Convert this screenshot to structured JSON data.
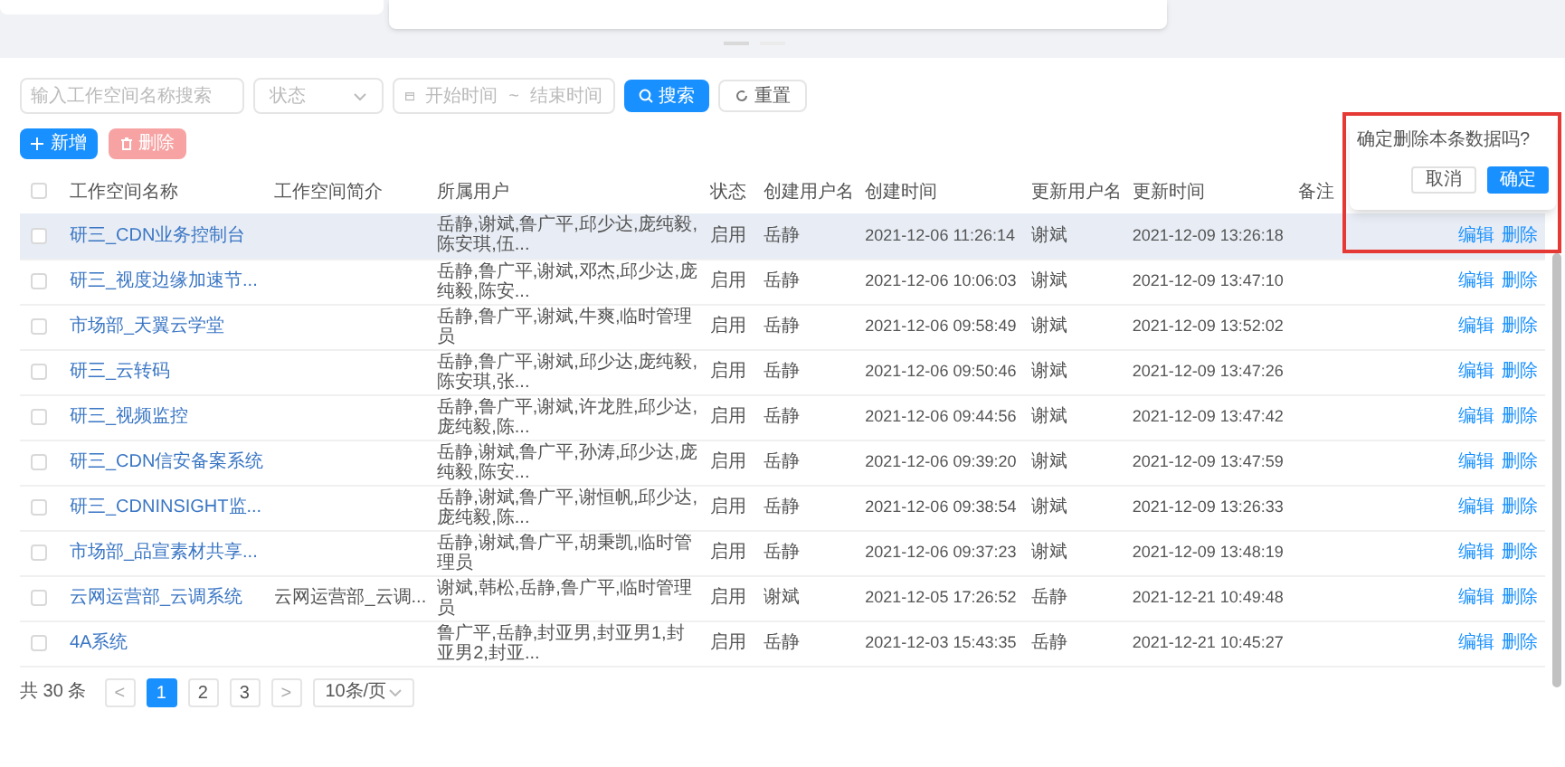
{
  "filters": {
    "name_search": {
      "placeholder": "输入工作空间名称搜索"
    },
    "status_select": {
      "placeholder": "状态"
    },
    "date_range": {
      "start_placeholder": "开始时间",
      "separator": "~",
      "end_placeholder": "结束时间"
    },
    "search_button": "搜索",
    "reset_button": "重置"
  },
  "actions": {
    "add_button": {
      "label": "新增",
      "disabled": false
    },
    "delete_button": {
      "label": "删除",
      "disabled": true
    }
  },
  "table": {
    "header_checked": false,
    "columns": [
      "工作空间名称",
      "工作空间简介",
      "所属用户",
      "状态",
      "创建用户名",
      "创建时间",
      "更新用户名",
      "更新时间",
      "备注"
    ],
    "rows": [
      {
        "checked": false,
        "hovered": true,
        "name": "研三_CDN业务控制台",
        "intro": "",
        "users": "岳静,谢斌,鲁广平,邱少达,庞纯毅,陈安琪,伍...",
        "status": "启用",
        "creator": "岳静",
        "created": "2021-12-06 11:26:14",
        "updater": "谢斌",
        "updated": "2021-12-09 13:26:18",
        "remark": "",
        "edit": "编辑",
        "delete": "删除"
      },
      {
        "checked": false,
        "hovered": false,
        "name": "研三_视度边缘加速节...",
        "intro": "",
        "users": "岳静,鲁广平,谢斌,邓杰,邱少达,庞纯毅,陈安...",
        "status": "启用",
        "creator": "岳静",
        "created": "2021-12-06 10:06:03",
        "updater": "谢斌",
        "updated": "2021-12-09 13:47:10",
        "remark": "",
        "edit": "编辑",
        "delete": "删除"
      },
      {
        "checked": false,
        "hovered": false,
        "name": "市场部_天翼云学堂",
        "intro": "",
        "users": "岳静,鲁广平,谢斌,牛爽,临时管理员",
        "status": "启用",
        "creator": "岳静",
        "created": "2021-12-06 09:58:49",
        "updater": "谢斌",
        "updated": "2021-12-09 13:52:02",
        "remark": "",
        "edit": "编辑",
        "delete": "删除"
      },
      {
        "checked": false,
        "hovered": false,
        "name": "研三_云转码",
        "intro": "",
        "users": "岳静,鲁广平,谢斌,邱少达,庞纯毅,陈安琪,张...",
        "status": "启用",
        "creator": "岳静",
        "created": "2021-12-06 09:50:46",
        "updater": "谢斌",
        "updated": "2021-12-09 13:47:26",
        "remark": "",
        "edit": "编辑",
        "delete": "删除"
      },
      {
        "checked": false,
        "hovered": false,
        "name": "研三_视频监控",
        "intro": "",
        "users": "岳静,鲁广平,谢斌,许龙胜,邱少达,庞纯毅,陈...",
        "status": "启用",
        "creator": "岳静",
        "created": "2021-12-06 09:44:56",
        "updater": "谢斌",
        "updated": "2021-12-09 13:47:42",
        "remark": "",
        "edit": "编辑",
        "delete": "删除"
      },
      {
        "checked": false,
        "hovered": false,
        "name": "研三_CDN信安备案系统",
        "intro": "",
        "users": "岳静,谢斌,鲁广平,孙涛,邱少达,庞纯毅,陈安...",
        "status": "启用",
        "creator": "岳静",
        "created": "2021-12-06 09:39:20",
        "updater": "谢斌",
        "updated": "2021-12-09 13:47:59",
        "remark": "",
        "edit": "编辑",
        "delete": "删除"
      },
      {
        "checked": false,
        "hovered": false,
        "name": "研三_CDNINSIGHT监...",
        "intro": "",
        "users": "岳静,谢斌,鲁广平,谢恒帆,邱少达,庞纯毅,陈...",
        "status": "启用",
        "creator": "岳静",
        "created": "2021-12-06 09:38:54",
        "updater": "谢斌",
        "updated": "2021-12-09 13:26:33",
        "remark": "",
        "edit": "编辑",
        "delete": "删除"
      },
      {
        "checked": false,
        "hovered": false,
        "name": "市场部_品宣素材共享...",
        "intro": "",
        "users": "岳静,谢斌,鲁广平,胡秉凯,临时管理员",
        "status": "启用",
        "creator": "岳静",
        "created": "2021-12-06 09:37:23",
        "updater": "谢斌",
        "updated": "2021-12-09 13:48:19",
        "remark": "",
        "edit": "编辑",
        "delete": "删除"
      },
      {
        "checked": false,
        "hovered": false,
        "name": "云网运营部_云调系统",
        "intro": "云网运营部_云调...",
        "users": "谢斌,韩松,岳静,鲁广平,临时管理员",
        "status": "启用",
        "creator": "谢斌",
        "created": "2021-12-05 17:26:52",
        "updater": "岳静",
        "updated": "2021-12-21 10:49:48",
        "remark": "",
        "edit": "编辑",
        "delete": "删除"
      },
      {
        "checked": false,
        "hovered": false,
        "name": "4A系统",
        "intro": "",
        "users": "鲁广平,岳静,封亚男,封亚男1,封亚男2,封亚...",
        "status": "启用",
        "creator": "岳静",
        "created": "2021-12-03 15:43:35",
        "updater": "岳静",
        "updated": "2021-12-21 10:45:27",
        "remark": "",
        "edit": "编辑",
        "delete": "删除"
      }
    ]
  },
  "pagination": {
    "total": "共 30 条",
    "prev": "<",
    "pages": [
      {
        "label": "1",
        "selected": true
      },
      {
        "label": "2",
        "selected": false
      },
      {
        "label": "3",
        "selected": false
      }
    ],
    "next": ">",
    "page_size": "10条/页"
  },
  "popconfirm": {
    "message": "确定删除本条数据吗?",
    "cancel": "取消",
    "confirm": "确定"
  }
}
